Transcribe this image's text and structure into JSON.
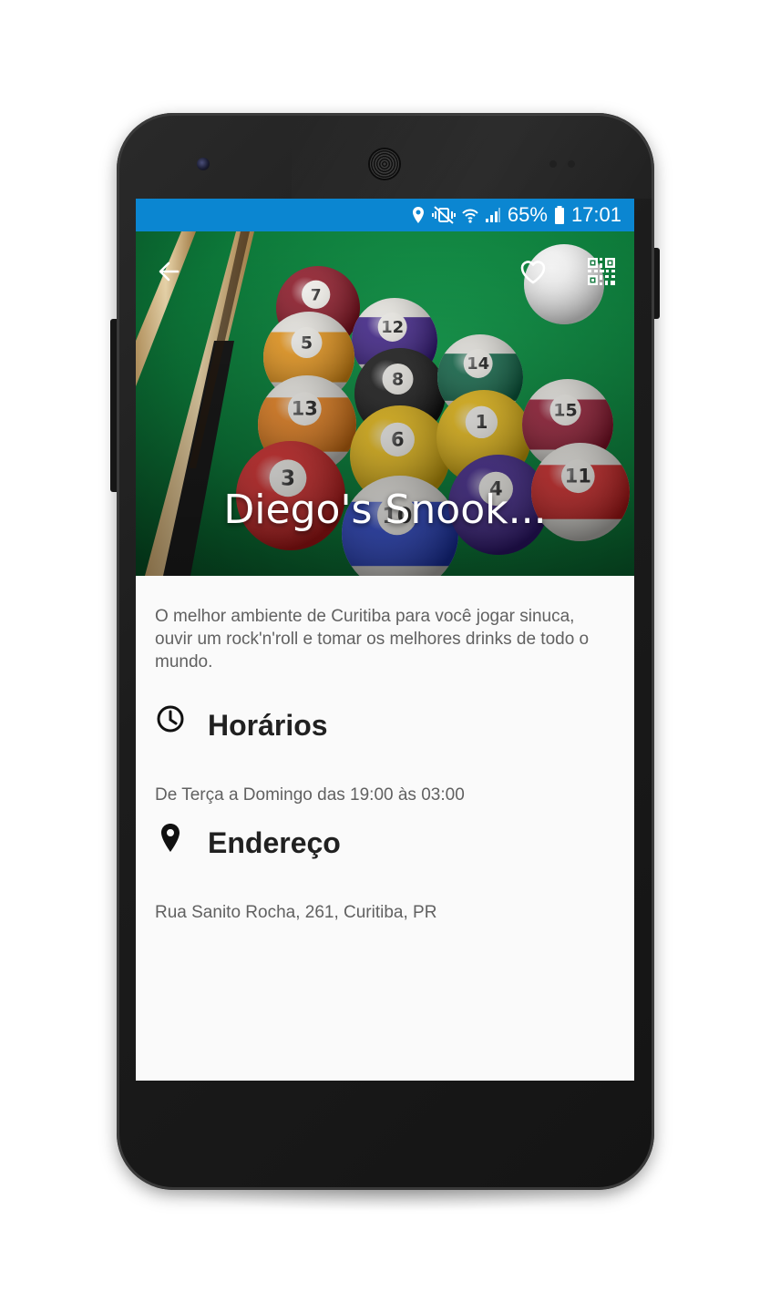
{
  "status_bar": {
    "icons": [
      "location-icon",
      "vibrate-mute-icon",
      "wifi-icon",
      "signal-icon",
      "battery-icon"
    ],
    "battery": "65%",
    "time": "17:01",
    "color": "#0b86d1"
  },
  "toolbar": {
    "back_icon": "arrow-back-icon",
    "favorite_icon": "heart-outline-icon",
    "qr_icon": "qr-code-icon"
  },
  "place": {
    "title": "Diego's Snook...",
    "description": "O melhor ambiente de Curitiba para você jogar sinuca, ouvir um rock'n'roll e tomar os melhores drinks de todo o mundo.",
    "hours_label": "Horários",
    "hours_icon": "clock-icon",
    "hours_text": "De Terça a Domingo das 19:00 às 03:00",
    "address_label": "Endereço",
    "address_icon": "map-pin-icon",
    "address_text": "Rua Sanito Rocha, 261, Curitiba, PR"
  },
  "hero_balls": [
    "7",
    "12",
    "5",
    "8",
    "14",
    "13",
    "6",
    "1",
    "15",
    "3",
    "10",
    "4",
    "11"
  ]
}
